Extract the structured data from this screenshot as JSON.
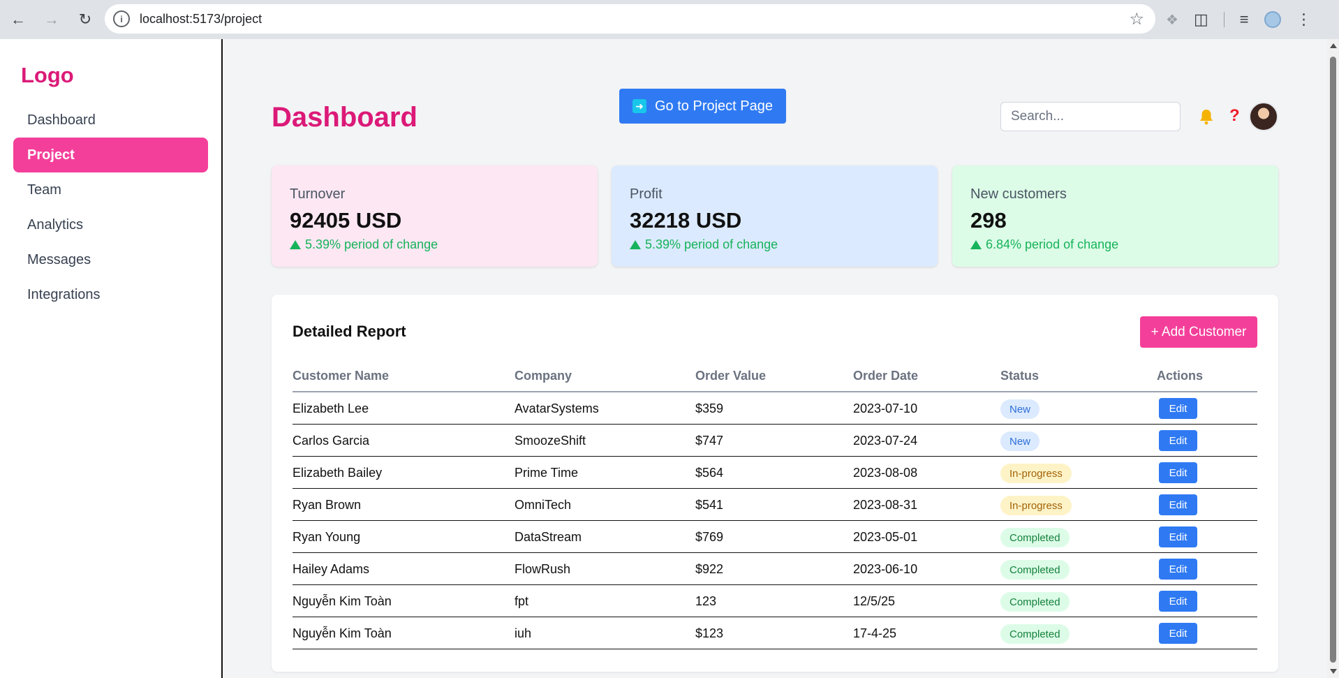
{
  "browser": {
    "url": "localhost:5173/project"
  },
  "sidebar": {
    "logo": "Logo",
    "items": [
      {
        "label": "Dashboard",
        "active": false
      },
      {
        "label": "Project",
        "active": true
      },
      {
        "label": "Team",
        "active": false
      },
      {
        "label": "Analytics",
        "active": false
      },
      {
        "label": "Messages",
        "active": false
      },
      {
        "label": "Integrations",
        "active": false
      }
    ]
  },
  "header": {
    "title": "Dashboard",
    "project_button": "Go to Project Page",
    "search_placeholder": "Search...",
    "help": "?"
  },
  "stats": [
    {
      "label": "Turnover",
      "value": "92405 USD",
      "change": "5.39% period of change",
      "bg": "#fce7f3"
    },
    {
      "label": "Profit",
      "value": "32218 USD",
      "change": "5.39% period of change",
      "bg": "#dbeafe"
    },
    {
      "label": "New customers",
      "value": "298",
      "change": "6.84% period of change",
      "bg": "#dcfce7"
    }
  ],
  "report": {
    "title": "Detailed Report",
    "add_button": "+ Add Customer",
    "columns": [
      "Customer Name",
      "Company",
      "Order Value",
      "Order Date",
      "Status",
      "Actions"
    ],
    "edit_label": "Edit",
    "rows": [
      {
        "name": "Elizabeth Lee",
        "company": "AvatarSystems",
        "value": "$359",
        "date": "2023-07-10",
        "status": "New"
      },
      {
        "name": "Carlos Garcia",
        "company": "SmoozeShift",
        "value": "$747",
        "date": "2023-07-24",
        "status": "New"
      },
      {
        "name": "Elizabeth Bailey",
        "company": "Prime Time",
        "value": "$564",
        "date": "2023-08-08",
        "status": "In-progress"
      },
      {
        "name": "Ryan Brown",
        "company": "OmniTech",
        "value": "$541",
        "date": "2023-08-31",
        "status": "In-progress"
      },
      {
        "name": "Ryan Young",
        "company": "DataStream",
        "value": "$769",
        "date": "2023-05-01",
        "status": "Completed"
      },
      {
        "name": "Hailey Adams",
        "company": "FlowRush",
        "value": "$922",
        "date": "2023-06-10",
        "status": "Completed"
      },
      {
        "name": "Nguyễn Kim Toàn",
        "company": "fpt",
        "value": "123",
        "date": "12/5/25",
        "status": "Completed"
      },
      {
        "name": "Nguyễn Kim Toàn",
        "company": "iuh",
        "value": "$123",
        "date": "17-4-25",
        "status": "Completed"
      }
    ]
  },
  "colors": {
    "brand_pink": "#db1a78",
    "active_pink": "#f43f9a",
    "primary_blue": "#2f7af3",
    "positive_green": "#16b35a"
  }
}
